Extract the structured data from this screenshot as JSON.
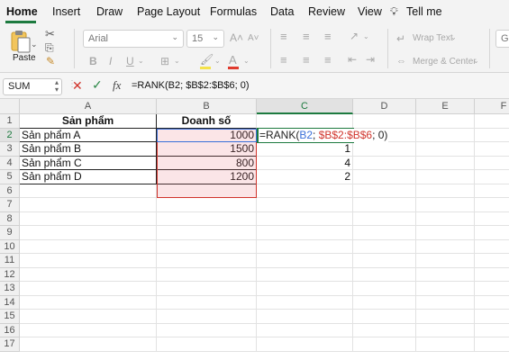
{
  "menu": {
    "tabs": [
      "Home",
      "Insert",
      "Draw",
      "Page Layout",
      "Formulas",
      "Data",
      "Review",
      "View"
    ],
    "tell_me": "Tell me"
  },
  "ribbon": {
    "paste_label": "Paste",
    "font_name": "Arial",
    "font_size": "15",
    "bold": "B",
    "italic": "I",
    "underline": "U",
    "wrap_text": "Wrap Text",
    "merge_center": "Merge & Center",
    "general_partial": "Ge"
  },
  "formula_bar": {
    "name_box": "SUM",
    "fx": "fx",
    "formula": "=RANK(B2; $B$2:$B$6; 0)"
  },
  "sheet": {
    "columns": [
      "A",
      "B",
      "C",
      "D",
      "E",
      "F"
    ],
    "rows": [
      "1",
      "2",
      "3",
      "4",
      "5",
      "6",
      "7",
      "8",
      "9",
      "10",
      "11",
      "12",
      "13",
      "14",
      "15",
      "16",
      "17"
    ],
    "header_a": "Sản phẩm",
    "header_b": "Doanh số",
    "products": [
      "Sản phẩm A",
      "Sản phẩm B",
      "Sản phẩm C",
      "Sản phẩm D"
    ],
    "sales": [
      "1000",
      "1500",
      "800",
      "1200"
    ],
    "ranks": [
      "1",
      "4",
      "2"
    ],
    "edit_formula": {
      "prefix": "=RANK(",
      "ref1": "B2",
      "sep1": "; ",
      "ref2": "$B$2:$B$6",
      "suffix": "; 0)"
    }
  },
  "colors": {
    "accent": "#1d7a3f",
    "ref_blue": "#3a6fd8",
    "ref_red": "#d0342c",
    "range_fill": "#fbe6e8"
  }
}
